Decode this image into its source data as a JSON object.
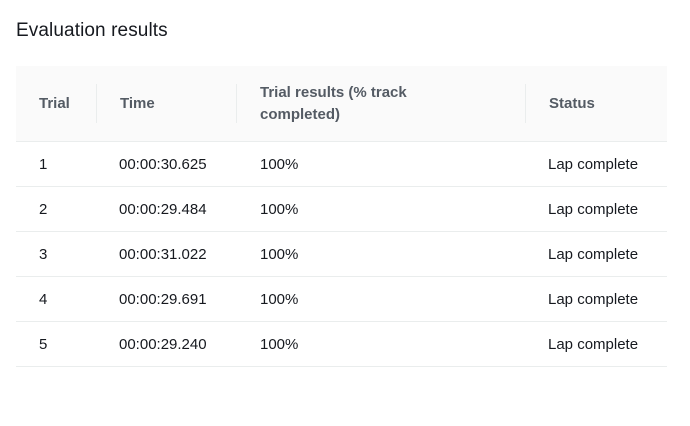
{
  "section": {
    "title": "Evaluation results"
  },
  "table": {
    "headers": {
      "trial": "Trial",
      "time": "Time",
      "result": "Trial results (% track completed)",
      "status": "Status"
    },
    "rows": [
      {
        "trial": "1",
        "time": "00:00:30.625",
        "result": "100%",
        "status": "Lap complete"
      },
      {
        "trial": "2",
        "time": "00:00:29.484",
        "result": "100%",
        "status": "Lap complete"
      },
      {
        "trial": "3",
        "time": "00:00:31.022",
        "result": "100%",
        "status": "Lap complete"
      },
      {
        "trial": "4",
        "time": "00:00:29.691",
        "result": "100%",
        "status": "Lap complete"
      },
      {
        "trial": "5",
        "time": "00:00:29.240",
        "result": "100%",
        "status": "Lap complete"
      }
    ]
  },
  "colors": {
    "header_bg": "#fafafa",
    "border": "#eaeded",
    "header_text": "#545b64",
    "body_text": "#16191f"
  }
}
